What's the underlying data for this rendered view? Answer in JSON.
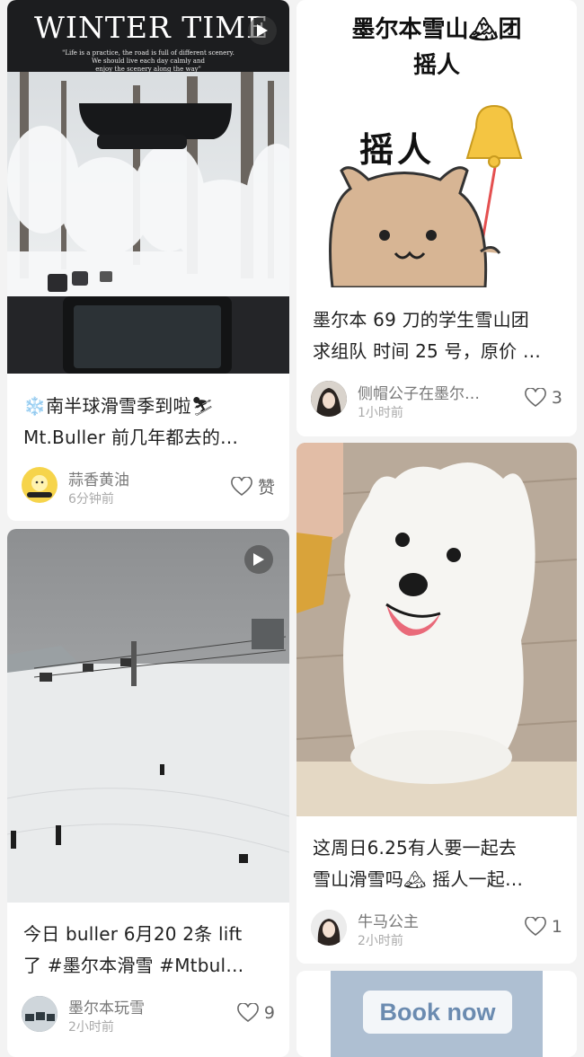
{
  "feed": [
    {
      "title_line1": "❄️南半球滑雪季到啦⛷",
      "title_line2": "Mt.Buller 前几年都去的…",
      "cover_title": "WINTER TIME",
      "cover_quote_1": "\"Life is a practice, the road is full of different scenery.",
      "cover_quote_2": "We should live each day calmly and",
      "cover_quote_3": "enjoy the scenery along the way\"",
      "author": "蒜香黄油",
      "time": "6分钟前",
      "likes": "赞"
    },
    {
      "title_line1": "今日 buller 6月20 2条 lift",
      "title_line2": "了 #墨尔本滑雪  #Mtbul…",
      "author": "墨尔本玩雪",
      "time": "2小时前",
      "likes": "9"
    },
    {
      "cover_heading_1": "墨尔本雪山🏔团",
      "cover_heading_2": "摇人",
      "cover_sticker_text": "摇人",
      "title_line1": "墨尔本 69 刀的学生雪山团",
      "title_line2": "求组队 时间 25 号，原价 …",
      "author": "侧帽公子在墨尔…",
      "time": "1小时前",
      "likes": "3"
    },
    {
      "title_line1": "这周日6.25有人要一起去",
      "title_line2": "雪山滑雪吗🏔 摇人一起…",
      "author": "牛马公主",
      "time": "2小时前",
      "likes": "1"
    },
    {
      "cover_button": "Book now"
    }
  ],
  "colors": {
    "page_bg": "#f3f3f3",
    "card_bg": "#ffffff",
    "title_text": "#222222",
    "meta_text": "#777777"
  },
  "icons": [
    "heart-icon",
    "play-icon"
  ]
}
